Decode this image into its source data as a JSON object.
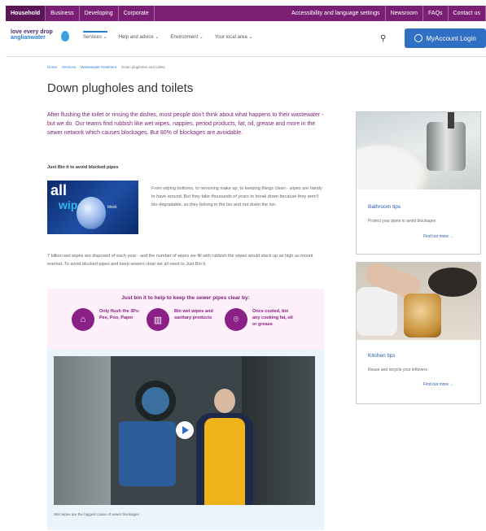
{
  "topbar": {
    "items": [
      "Household",
      "Business",
      "Developing",
      "Corporate"
    ],
    "right": [
      "Accessibility and language settings",
      "Newsroom",
      "FAQs",
      "Contact us"
    ]
  },
  "header": {
    "logo_line1": "love every drop",
    "logo_line2": "anglianwater",
    "nav": [
      "Services",
      "Help and advice",
      "Environment",
      "Your local area"
    ],
    "account_label": "MyAccount Login"
  },
  "breadcrumb": [
    "Home",
    "Services",
    "Wastewater treatment",
    "Down plugholes and toilets"
  ],
  "page": {
    "title": "Down plugholes and toilets",
    "intro": "After flushing the toilet or rinsing the dishes, most people don't think about what happens to their wastewater - but we do. Our teams find rubbish like wet wipes, nappies, period products, fat, oil, grease and more in the sewer network which causes blockages. But 80% of blockages are avoidable.",
    "subheading": "Just Bin it to avoid blocked pipes",
    "promo_badge1": "all",
    "promo_badge2": "wipes",
    "promo_badge3": "block",
    "promo_text": "From wiping bottoms, to removing make up, to keeping things clean - wipes are handy to have around. But they take thousands of years to break down because they aren't bio-degradable, so they belong in the bin and not down the loo.",
    "para2": "7 billion wet wipes are disposed of each year - and the number of wipes we fill with rubbish the wipes would stack up as high as mount everest. To avoid blocked pipes and keep sewers clear we all need to Just Bin it."
  },
  "binit": {
    "heading": "Just bin it to help to keep the sewer pipes clear by:",
    "items": [
      {
        "icon": "toilet-icon",
        "glyph": "⌂",
        "text": "Only flush the 3Ps: Pee, Poo, Paper"
      },
      {
        "icon": "bin-icon",
        "glyph": "▥",
        "text": "Bin wet wipes and sanitary products"
      },
      {
        "icon": "oil-drop-icon",
        "glyph": "⌾",
        "text": "Once cooled, bin any cooking fat, oil or grease"
      }
    ]
  },
  "video": {
    "caption": "Wet wipes are the biggest cause of sewer blockages"
  },
  "cards": [
    {
      "title": "Bathroom tips",
      "desc": "Protect your pipes to avoid blockages",
      "link": "Find out more →"
    },
    {
      "title": "Kitchen tips",
      "desc": "Reuse and recycle your leftovers",
      "link": "Find out more →"
    }
  ],
  "colors": {
    "brand_purple": "#7a1f73",
    "brand_blue": "#2f6fc4"
  }
}
